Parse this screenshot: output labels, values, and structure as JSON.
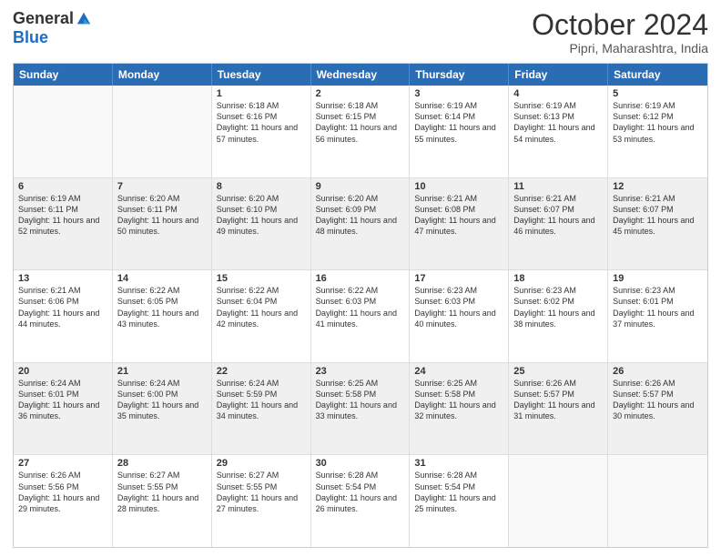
{
  "header": {
    "logo_general": "General",
    "logo_blue": "Blue",
    "month_title": "October 2024",
    "location": "Pipri, Maharashtra, India"
  },
  "calendar": {
    "days": [
      "Sunday",
      "Monday",
      "Tuesday",
      "Wednesday",
      "Thursday",
      "Friday",
      "Saturday"
    ],
    "rows": [
      [
        {
          "day": "",
          "content": "",
          "empty": true
        },
        {
          "day": "",
          "content": "",
          "empty": true
        },
        {
          "day": "1",
          "content": "Sunrise: 6:18 AM\nSunset: 6:16 PM\nDaylight: 11 hours and 57 minutes."
        },
        {
          "day": "2",
          "content": "Sunrise: 6:18 AM\nSunset: 6:15 PM\nDaylight: 11 hours and 56 minutes."
        },
        {
          "day": "3",
          "content": "Sunrise: 6:19 AM\nSunset: 6:14 PM\nDaylight: 11 hours and 55 minutes."
        },
        {
          "day": "4",
          "content": "Sunrise: 6:19 AM\nSunset: 6:13 PM\nDaylight: 11 hours and 54 minutes."
        },
        {
          "day": "5",
          "content": "Sunrise: 6:19 AM\nSunset: 6:12 PM\nDaylight: 11 hours and 53 minutes."
        }
      ],
      [
        {
          "day": "6",
          "content": "Sunrise: 6:19 AM\nSunset: 6:11 PM\nDaylight: 11 hours and 52 minutes.",
          "shaded": true
        },
        {
          "day": "7",
          "content": "Sunrise: 6:20 AM\nSunset: 6:11 PM\nDaylight: 11 hours and 50 minutes.",
          "shaded": true
        },
        {
          "day": "8",
          "content": "Sunrise: 6:20 AM\nSunset: 6:10 PM\nDaylight: 11 hours and 49 minutes.",
          "shaded": true
        },
        {
          "day": "9",
          "content": "Sunrise: 6:20 AM\nSunset: 6:09 PM\nDaylight: 11 hours and 48 minutes.",
          "shaded": true
        },
        {
          "day": "10",
          "content": "Sunrise: 6:21 AM\nSunset: 6:08 PM\nDaylight: 11 hours and 47 minutes.",
          "shaded": true
        },
        {
          "day": "11",
          "content": "Sunrise: 6:21 AM\nSunset: 6:07 PM\nDaylight: 11 hours and 46 minutes.",
          "shaded": true
        },
        {
          "day": "12",
          "content": "Sunrise: 6:21 AM\nSunset: 6:07 PM\nDaylight: 11 hours and 45 minutes.",
          "shaded": true
        }
      ],
      [
        {
          "day": "13",
          "content": "Sunrise: 6:21 AM\nSunset: 6:06 PM\nDaylight: 11 hours and 44 minutes."
        },
        {
          "day": "14",
          "content": "Sunrise: 6:22 AM\nSunset: 6:05 PM\nDaylight: 11 hours and 43 minutes."
        },
        {
          "day": "15",
          "content": "Sunrise: 6:22 AM\nSunset: 6:04 PM\nDaylight: 11 hours and 42 minutes."
        },
        {
          "day": "16",
          "content": "Sunrise: 6:22 AM\nSunset: 6:03 PM\nDaylight: 11 hours and 41 minutes."
        },
        {
          "day": "17",
          "content": "Sunrise: 6:23 AM\nSunset: 6:03 PM\nDaylight: 11 hours and 40 minutes."
        },
        {
          "day": "18",
          "content": "Sunrise: 6:23 AM\nSunset: 6:02 PM\nDaylight: 11 hours and 38 minutes."
        },
        {
          "day": "19",
          "content": "Sunrise: 6:23 AM\nSunset: 6:01 PM\nDaylight: 11 hours and 37 minutes."
        }
      ],
      [
        {
          "day": "20",
          "content": "Sunrise: 6:24 AM\nSunset: 6:01 PM\nDaylight: 11 hours and 36 minutes.",
          "shaded": true
        },
        {
          "day": "21",
          "content": "Sunrise: 6:24 AM\nSunset: 6:00 PM\nDaylight: 11 hours and 35 minutes.",
          "shaded": true
        },
        {
          "day": "22",
          "content": "Sunrise: 6:24 AM\nSunset: 5:59 PM\nDaylight: 11 hours and 34 minutes.",
          "shaded": true
        },
        {
          "day": "23",
          "content": "Sunrise: 6:25 AM\nSunset: 5:58 PM\nDaylight: 11 hours and 33 minutes.",
          "shaded": true
        },
        {
          "day": "24",
          "content": "Sunrise: 6:25 AM\nSunset: 5:58 PM\nDaylight: 11 hours and 32 minutes.",
          "shaded": true
        },
        {
          "day": "25",
          "content": "Sunrise: 6:26 AM\nSunset: 5:57 PM\nDaylight: 11 hours and 31 minutes.",
          "shaded": true
        },
        {
          "day": "26",
          "content": "Sunrise: 6:26 AM\nSunset: 5:57 PM\nDaylight: 11 hours and 30 minutes.",
          "shaded": true
        }
      ],
      [
        {
          "day": "27",
          "content": "Sunrise: 6:26 AM\nSunset: 5:56 PM\nDaylight: 11 hours and 29 minutes."
        },
        {
          "day": "28",
          "content": "Sunrise: 6:27 AM\nSunset: 5:55 PM\nDaylight: 11 hours and 28 minutes."
        },
        {
          "day": "29",
          "content": "Sunrise: 6:27 AM\nSunset: 5:55 PM\nDaylight: 11 hours and 27 minutes."
        },
        {
          "day": "30",
          "content": "Sunrise: 6:28 AM\nSunset: 5:54 PM\nDaylight: 11 hours and 26 minutes."
        },
        {
          "day": "31",
          "content": "Sunrise: 6:28 AM\nSunset: 5:54 PM\nDaylight: 11 hours and 25 minutes."
        },
        {
          "day": "",
          "content": "",
          "empty": true
        },
        {
          "day": "",
          "content": "",
          "empty": true
        }
      ]
    ]
  }
}
